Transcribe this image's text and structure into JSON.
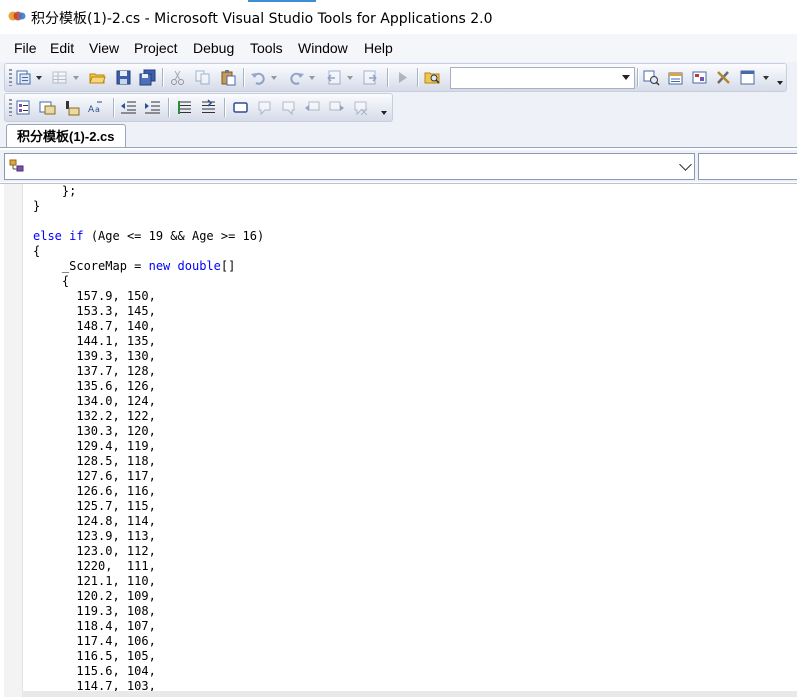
{
  "window": {
    "title": "积分模板(1)-2.cs - Microsoft Visual Studio Tools for Applications 2.0"
  },
  "menu": [
    "File",
    "Edit",
    "View",
    "Project",
    "Debug",
    "Tools",
    "Window",
    "Help"
  ],
  "toolbar": {
    "combo_value": "",
    "icons": [
      "solution-explorer-icon",
      "grid-icon",
      "open-icon",
      "save-icon",
      "save-all-icon",
      "cut-icon",
      "copy-icon",
      "paste-icon",
      "undo-icon",
      "redo-icon",
      "navigate-back-icon",
      "navigate-forward-icon",
      "start-icon",
      "find-in-files-icon",
      "properties-icon",
      "object-browser-icon",
      "toolbox-icon",
      "tools-icon",
      "other-windows-icon"
    ],
    "text_editor_icons": [
      "display-members-icon",
      "parameter-info-icon",
      "quick-info-icon",
      "complete-word-icon",
      "decrease-indent-icon",
      "increase-indent-icon",
      "comment-lines-icon",
      "uncomment-lines-icon",
      "toggle-bookmark-icon",
      "previous-bookmark-icon",
      "next-bookmark-icon",
      "previous-bookmark-in-folder-icon",
      "next-bookmark-in-folder-icon",
      "clear-bookmarks-icon"
    ]
  },
  "tab": {
    "label": "积分模板(1)-2.cs"
  },
  "navigation": {
    "type_value": "",
    "member_value": ""
  },
  "code_lines": [
    "    };",
    "}",
    "",
    "else if (Age <= 19 && Age >= 16)",
    "{",
    "    _ScoreMap = new double[]",
    "    {",
    "      157.9, 150,",
    "      153.3, 145,",
    "      148.7, 140,",
    "      144.1, 135,",
    "      139.3, 130,",
    "      137.7, 128,",
    "      135.6, 126,",
    "      134.0, 124,",
    "      132.2, 122,",
    "      130.3, 120,",
    "      129.4, 119,",
    "      128.5, 118,",
    "      127.6, 117,",
    "      126.6, 116,",
    "      125.7, 115,",
    "      124.8, 114,",
    "      123.9, 113,",
    "      123.0, 112,",
    "      1220,  111,",
    "      121.1, 110,",
    "      120.2, 109,",
    "      119.3, 108,",
    "      118.4, 107,",
    "      117.4, 106,",
    "      116.5, 105,",
    "      115.6, 104,",
    "      114.7, 103,"
  ],
  "colors": {
    "keyword": "#0000ff",
    "text": "#000000",
    "chrome": "#eef1f7",
    "accent": "#3c8fd6"
  }
}
